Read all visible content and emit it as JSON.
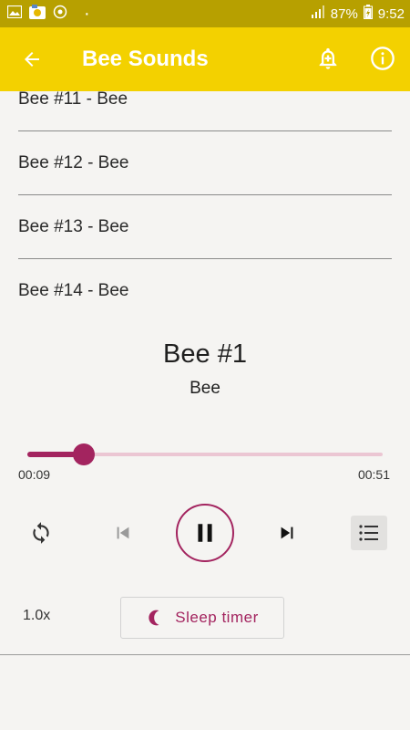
{
  "status_bar": {
    "battery": "87%",
    "time": "9:52",
    "dot": "·"
  },
  "app_bar": {
    "title": "Bee Sounds",
    "back_icon": "arrow-left-icon",
    "alarm_icon": "alarm-add-icon",
    "info_icon": "info-icon"
  },
  "tracks": [
    {
      "label": "Bee #11 - Bee"
    },
    {
      "label": "Bee #12 - Bee"
    },
    {
      "label": "Bee #13 - Bee"
    },
    {
      "label": "Bee #14 - Bee"
    }
  ],
  "now_playing": {
    "title": "Bee #1",
    "artist": "Bee",
    "current_time": "00:09",
    "total_time": "00:51",
    "progress_fraction": 0.16
  },
  "controls": {
    "speed": "1.0x",
    "sleep_timer_label": "Sleep timer"
  },
  "colors": {
    "status_bar": "#b7a000",
    "app_bar": "#f3d100",
    "accent": "#a3245f",
    "progress_track": "#ebc6d3",
    "background": "#f5f4f2"
  }
}
